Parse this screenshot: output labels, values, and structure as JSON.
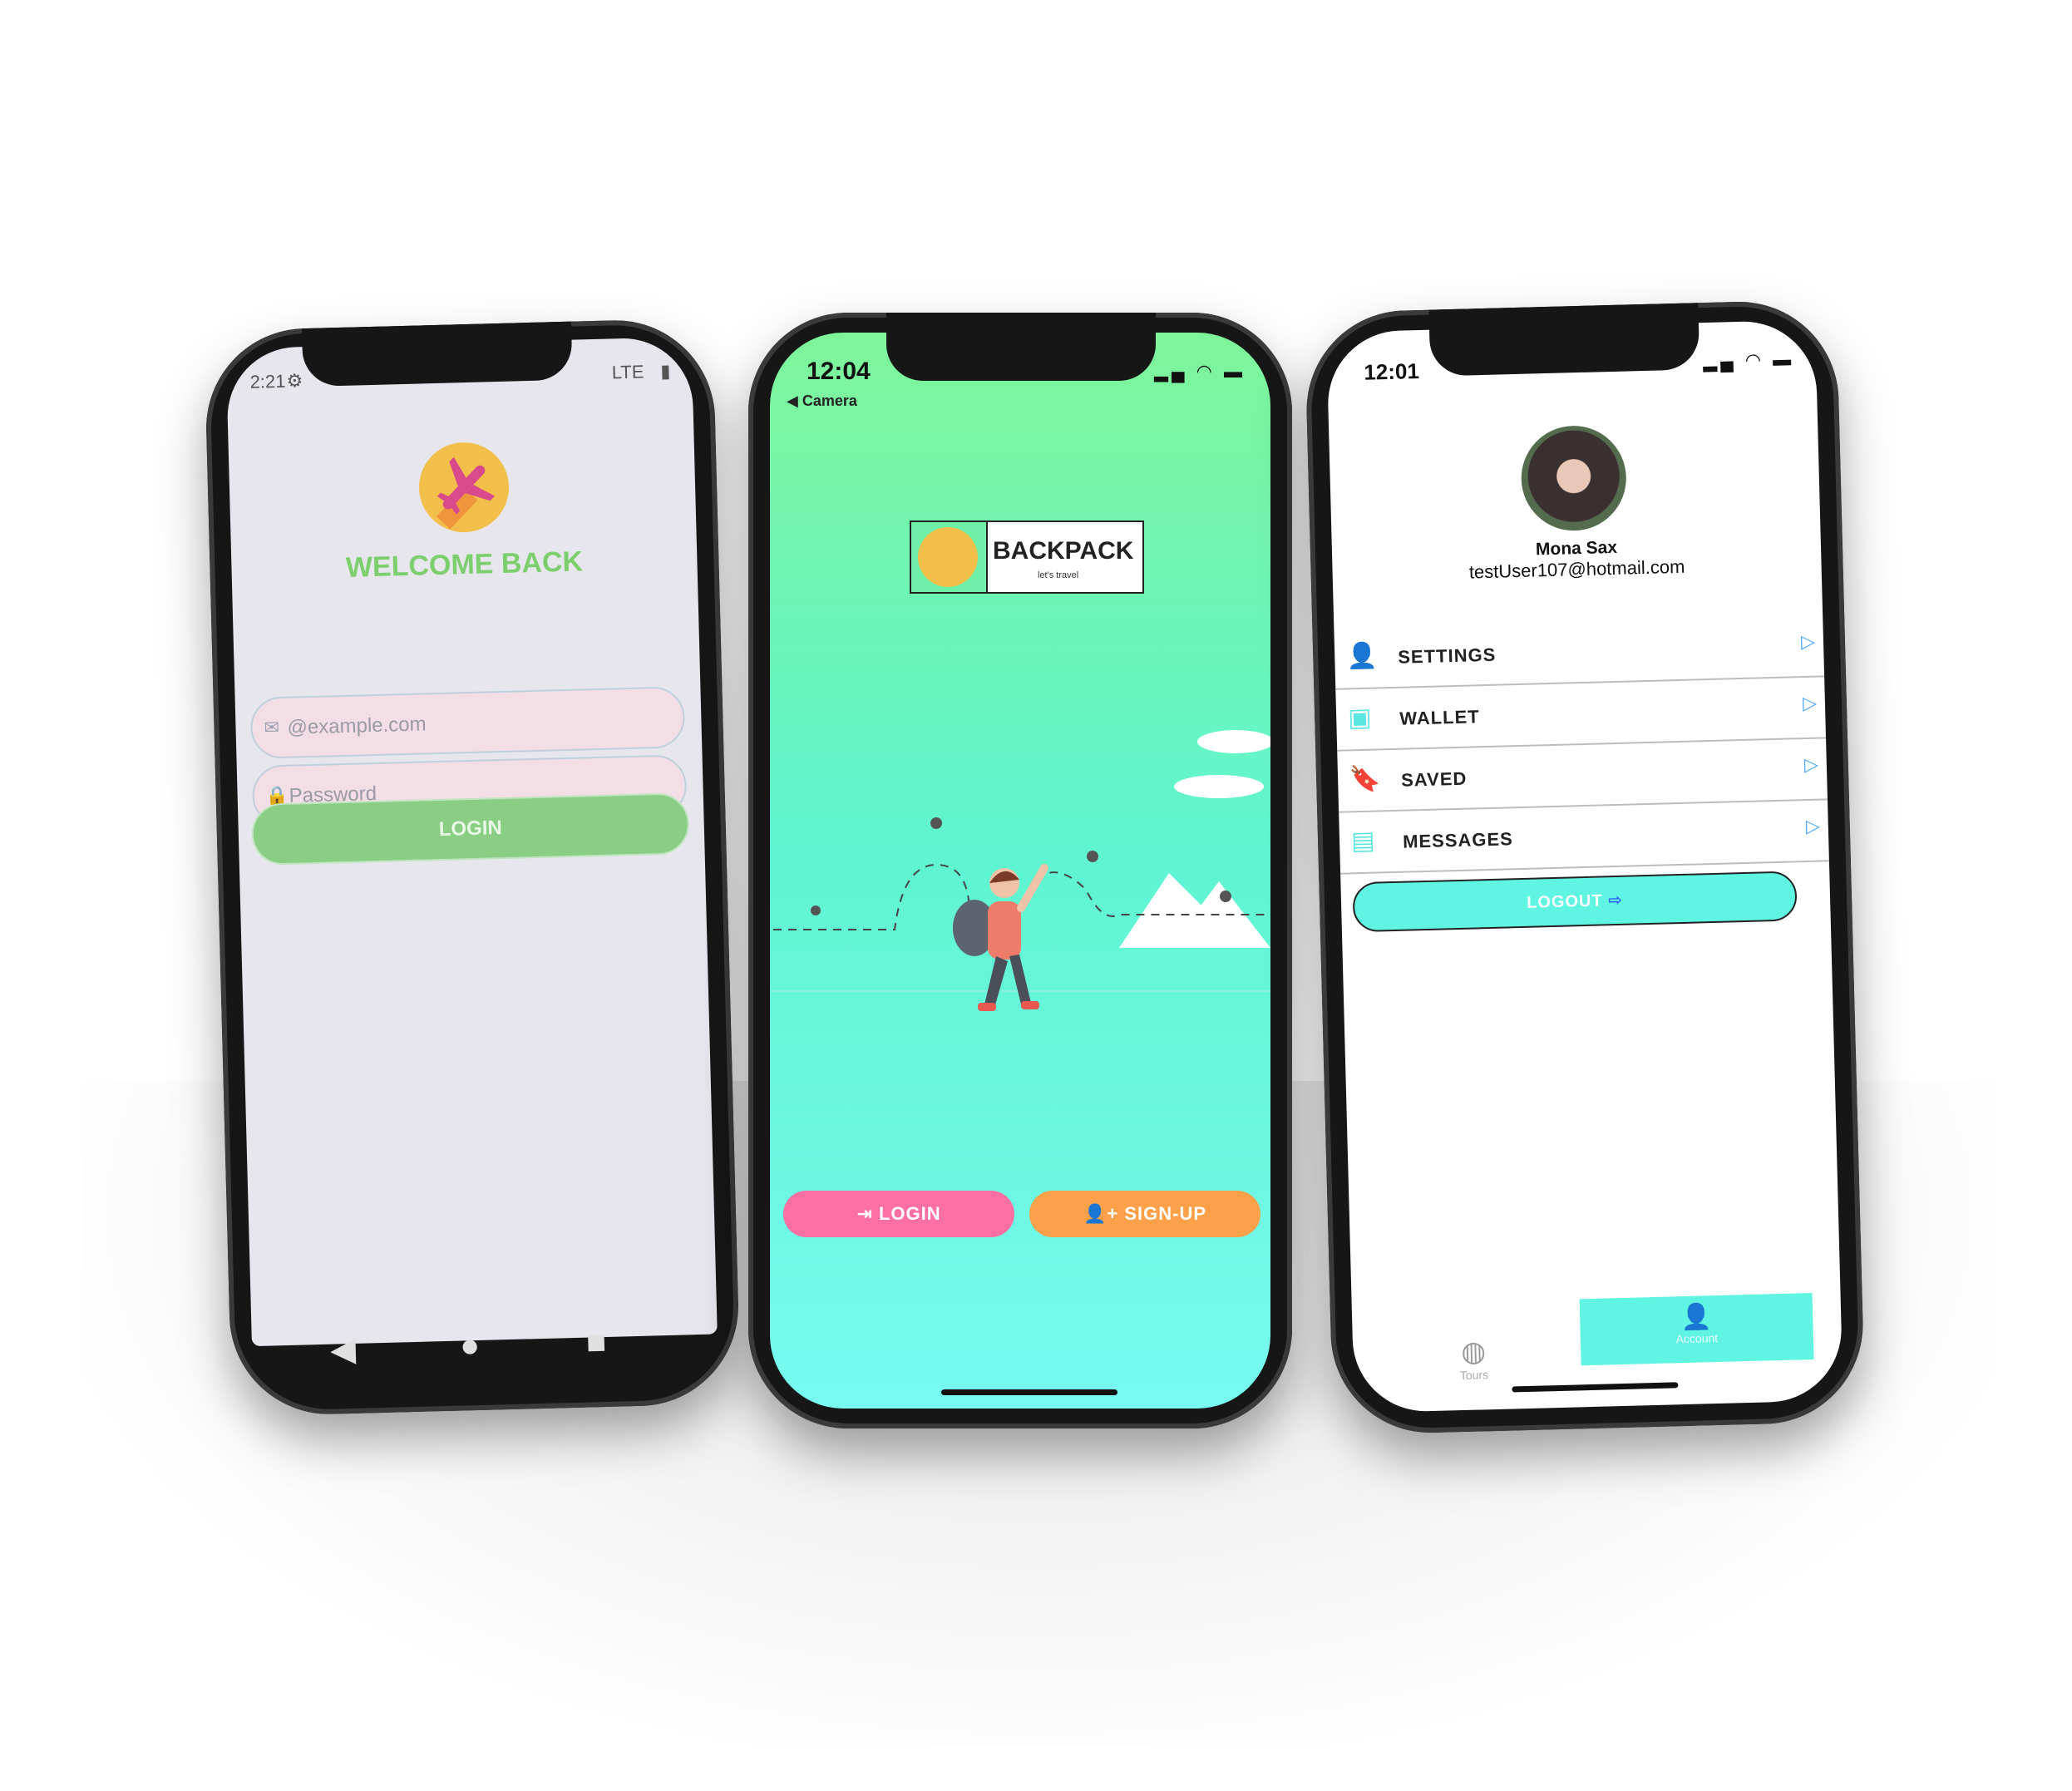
{
  "phone1": {
    "status_time": "2:21",
    "status_network": "LTE",
    "title": "WELCOME BACK",
    "email_placeholder": "@example.com",
    "password_placeholder": "Password",
    "login_label": "LOGIN",
    "nav": [
      "◀",
      "●",
      "■"
    ]
  },
  "phone2": {
    "status_time": "12:04",
    "back_label": "◀ Camera",
    "brand_name": "BACKPACK",
    "brand_tagline": "let's travel",
    "login_label": "LOGIN",
    "signup_label": "SIGN-UP"
  },
  "phone3": {
    "status_time": "12:01",
    "user_name": "Mona Sax",
    "user_email": "testUser107@hotmail.com",
    "menu": [
      {
        "label": "SETTINGS",
        "icon": "user-icon"
      },
      {
        "label": "WALLET",
        "icon": "wallet-icon"
      },
      {
        "label": "SAVED",
        "icon": "bookmark-icon"
      },
      {
        "label": "MESSAGES",
        "icon": "message-icon"
      }
    ],
    "logout_label": "LOGOUT",
    "tabs": {
      "tours": "Tours",
      "account": "Account"
    }
  },
  "colors": {
    "brand_green": "#7ccf6c",
    "teal": "#5ff5e2",
    "pink": "#fb6fa3",
    "orange": "#fda04a"
  }
}
